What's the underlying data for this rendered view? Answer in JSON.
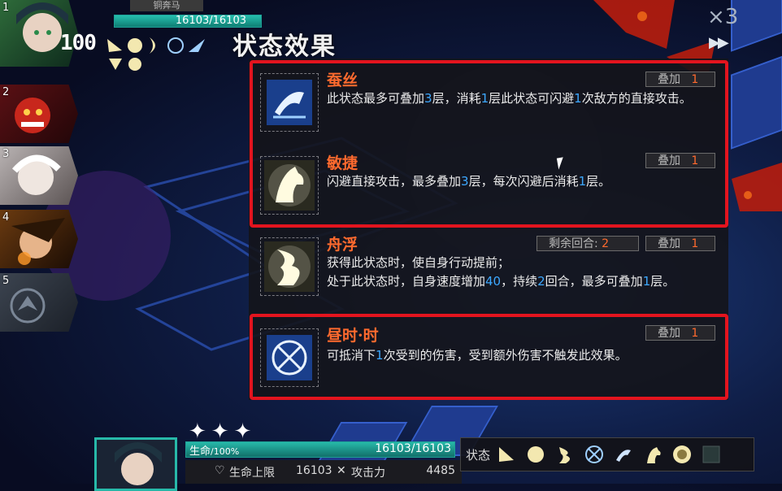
{
  "top_unit": {
    "name": "铜奔马",
    "hp": "16103/16103",
    "level": "100"
  },
  "game_speed": "×3",
  "fast_forward": "▶▶",
  "party_slots": [
    "1",
    "2",
    "3",
    "4",
    "5"
  ],
  "panel": {
    "title": "状态效果",
    "effects": [
      {
        "name": "蚕丝",
        "icon": "silkworm-icon",
        "stack_label": "叠加",
        "stack_value": "1",
        "desc": [
          {
            "t": "此状态最多可叠加"
          },
          {
            "h": "3"
          },
          {
            "t": "层，消耗"
          },
          {
            "h": "1"
          },
          {
            "t": "层此状态可闪避"
          },
          {
            "h": "1"
          },
          {
            "t": "次敌方的直接攻击。"
          }
        ]
      },
      {
        "name": "敏捷",
        "icon": "horse-head-icon",
        "stack_label": "叠加",
        "stack_value": "1",
        "desc": [
          {
            "t": "闪避直接攻击，最多叠加"
          },
          {
            "h": "3"
          },
          {
            "t": "层，每次闪避后消耗"
          },
          {
            "h": "1"
          },
          {
            "t": "层。"
          }
        ]
      },
      {
        "name": "舟浮",
        "icon": "wave-hand-icon",
        "turns_label": "剩余回合:",
        "turns_value": "2",
        "stack_label": "叠加",
        "stack_value": "1",
        "desc": [
          {
            "t": "获得此状态时，使自身行动提前；"
          },
          {
            "br": true
          },
          {
            "t": "处于此状态时，自身速度增加"
          },
          {
            "h": "40"
          },
          {
            "t": "，持续"
          },
          {
            "h": "2"
          },
          {
            "t": "回合，最多可叠加"
          },
          {
            "h": "1"
          },
          {
            "t": "层。"
          }
        ]
      },
      {
        "name": "昼时·时",
        "icon": "crossed-swords-circle-icon",
        "stack_label": "叠加",
        "stack_value": "1",
        "desc": [
          {
            "t": "可抵消下"
          },
          {
            "h": "1"
          },
          {
            "t": "次受到的伤害，受到额外伤害不触发此效果。"
          }
        ]
      }
    ]
  },
  "bottom_unit": {
    "hp_label": "生命",
    "hp_percent": "/100%",
    "hp": "16103/16103",
    "max_hp_label": "生命上限",
    "max_hp": "16103",
    "atk_label": "攻击力",
    "atk": "4485",
    "stars": "✦✦✦"
  },
  "status_bar": {
    "label": "状态",
    "icons": [
      "claw-icon",
      "fist-icon",
      "wave-hand-icon",
      "crossed-swords-circle-icon",
      "silkworm-icon",
      "horse-head-icon",
      "fist-circle-icon",
      "locked-slot-icon"
    ]
  },
  "colors": {
    "effect_name": "#ff6a2e",
    "highlight_number": "#3da8ff",
    "highlight_border": "#e3141e",
    "hp_bar": "#27b9a9"
  }
}
